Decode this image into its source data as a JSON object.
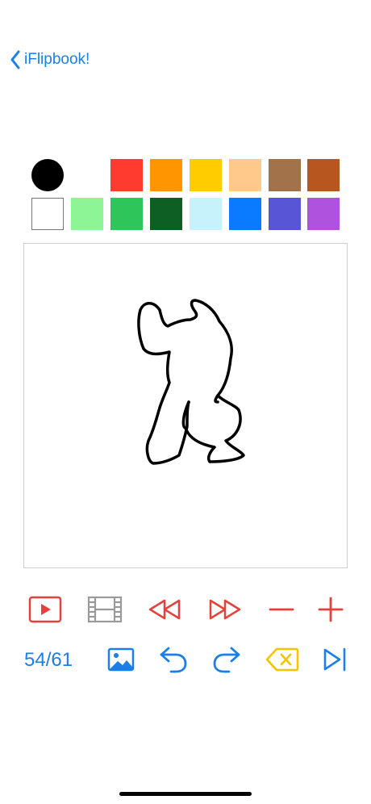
{
  "nav": {
    "back_label": "iFlipbook!"
  },
  "palette": {
    "selected_color": "#000000",
    "row1": [
      "#ff3b30",
      "#ff9500",
      "#ffcc00",
      "#ffc98a",
      "#a2734a",
      "#b8561f"
    ],
    "row2": [
      "#ffffff",
      "#8ef597",
      "#2ec55a",
      "#0d5f23",
      "#c8f2fb",
      "#0a7bff",
      "#5856d6",
      "#af52de"
    ]
  },
  "toolbar": {
    "frame_counter": "54/61",
    "play_icon": "play-icon",
    "filmstrip_icon": "filmstrip-icon",
    "rewind_icon": "rewind-icon",
    "fast_forward_icon": "fast-forward-icon",
    "minus_icon": "minus-icon",
    "plus_icon": "plus-icon",
    "image_icon": "image-icon",
    "undo_icon": "undo-icon",
    "redo_icon": "redo-icon",
    "delete_icon": "delete-icon",
    "last_frame_icon": "last-frame-icon"
  },
  "colors": {
    "accent_blue": "#1a7fe8",
    "accent_red": "#e5413a",
    "accent_yellow": "#f4c400",
    "disabled_gray": "#9a9a9a"
  }
}
